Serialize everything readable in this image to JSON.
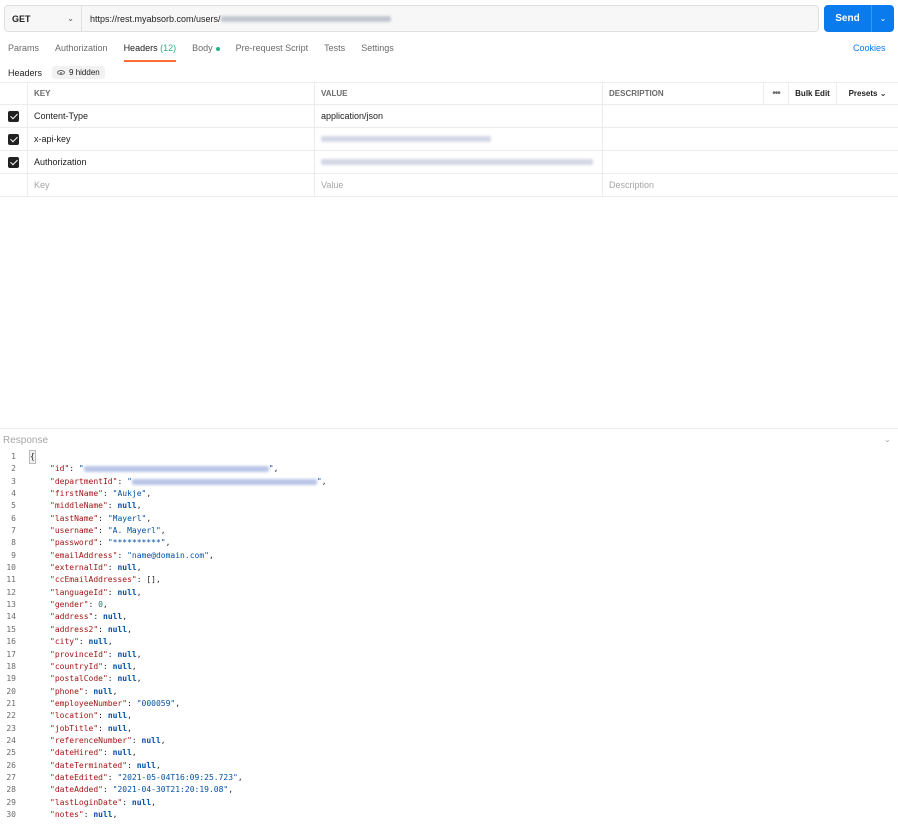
{
  "request": {
    "method": "GET",
    "url_visible": "https://rest.myabsorb.com/users/",
    "send_label": "Send"
  },
  "tabs": [
    {
      "label": "Params"
    },
    {
      "label": "Authorization"
    },
    {
      "label": "Headers",
      "count": "(12)"
    },
    {
      "label": "Body"
    },
    {
      "label": "Pre-request Script"
    },
    {
      "label": "Tests"
    },
    {
      "label": "Settings"
    }
  ],
  "cookies_label": "Cookies",
  "subbar": {
    "label": "Headers",
    "hidden": "9 hidden"
  },
  "headers_table": {
    "columns": {
      "key": "KEY",
      "value": "VALUE",
      "description": "DESCRIPTION",
      "more": "•••",
      "bulk_edit": "Bulk Edit",
      "presets": "Presets"
    },
    "rows": [
      {
        "key": "Content-Type",
        "value": "application/json"
      },
      {
        "key": "x-api-key",
        "value": ""
      },
      {
        "key": "Authorization",
        "value": ""
      }
    ],
    "placeholders": {
      "key": "Key",
      "value": "Value",
      "description": "Description"
    }
  },
  "response": {
    "label": "Response",
    "lines": [
      {
        "n": "1",
        "type": "brace",
        "text": "{"
      },
      {
        "n": "2",
        "key": "\"id\"",
        "value": "",
        "vtype": "blur",
        "blurw": 185
      },
      {
        "n": "3",
        "key": "\"departmentId\"",
        "value": "",
        "vtype": "blur",
        "blurw": 185
      },
      {
        "n": "4",
        "key": "\"firstName\"",
        "value": "\"Aukje\"",
        "vtype": "s"
      },
      {
        "n": "5",
        "key": "\"middleName\"",
        "value": "null",
        "vtype": "kw"
      },
      {
        "n": "6",
        "key": "\"lastName\"",
        "value": "\"Mayerl\"",
        "vtype": "s"
      },
      {
        "n": "7",
        "key": "\"username\"",
        "value": "\"A. Mayerl\"",
        "vtype": "s"
      },
      {
        "n": "8",
        "key": "\"password\"",
        "value": "\"**********\"",
        "vtype": "s"
      },
      {
        "n": "9",
        "key": "\"emailAddress\"",
        "value": "\"name@domain.com\"",
        "vtype": "s"
      },
      {
        "n": "10",
        "key": "\"externalId\"",
        "value": "null",
        "vtype": "kw"
      },
      {
        "n": "11",
        "key": "\"ccEmailAddresses\"",
        "value": "[]",
        "vtype": "p"
      },
      {
        "n": "12",
        "key": "\"languageId\"",
        "value": "null",
        "vtype": "kw"
      },
      {
        "n": "13",
        "key": "\"gender\"",
        "value": "0",
        "vtype": "n"
      },
      {
        "n": "14",
        "key": "\"address\"",
        "value": "null",
        "vtype": "kw"
      },
      {
        "n": "15",
        "key": "\"address2\"",
        "value": "null",
        "vtype": "kw"
      },
      {
        "n": "16",
        "key": "\"city\"",
        "value": "null",
        "vtype": "kw"
      },
      {
        "n": "17",
        "key": "\"provinceId\"",
        "value": "null",
        "vtype": "kw"
      },
      {
        "n": "18",
        "key": "\"countryId\"",
        "value": "null",
        "vtype": "kw"
      },
      {
        "n": "19",
        "key": "\"postalCode\"",
        "value": "null",
        "vtype": "kw"
      },
      {
        "n": "20",
        "key": "\"phone\"",
        "value": "null",
        "vtype": "kw"
      },
      {
        "n": "21",
        "key": "\"employeeNumber\"",
        "value": "\"000059\"",
        "vtype": "s"
      },
      {
        "n": "22",
        "key": "\"location\"",
        "value": "null",
        "vtype": "kw"
      },
      {
        "n": "23",
        "key": "\"jobTitle\"",
        "value": "null",
        "vtype": "kw"
      },
      {
        "n": "24",
        "key": "\"referenceNumber\"",
        "value": "null",
        "vtype": "kw"
      },
      {
        "n": "25",
        "key": "\"dateHired\"",
        "value": "null",
        "vtype": "kw"
      },
      {
        "n": "26",
        "key": "\"dateTerminated\"",
        "value": "null",
        "vtype": "kw"
      },
      {
        "n": "27",
        "key": "\"dateEdited\"",
        "value": "\"2021-05-04T16:09:25.723\"",
        "vtype": "s"
      },
      {
        "n": "28",
        "key": "\"dateAdded\"",
        "value": "\"2021-04-30T21:20:19.08\"",
        "vtype": "s"
      },
      {
        "n": "29",
        "key": "\"lastLoginDate\"",
        "value": "null",
        "vtype": "kw"
      },
      {
        "n": "30",
        "key": "\"notes\"",
        "value": "null",
        "vtype": "kw"
      }
    ]
  }
}
